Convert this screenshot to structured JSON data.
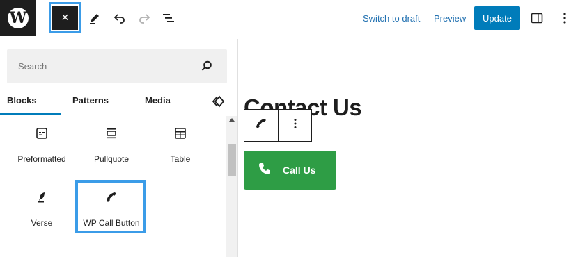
{
  "toolbar": {
    "close_label": "×",
    "switch_to_draft": "Switch to draft",
    "preview": "Preview",
    "update": "Update",
    "logo_glyph": "W"
  },
  "inserter": {
    "search_placeholder": "Search",
    "tabs": [
      {
        "label": "Blocks",
        "active": true
      },
      {
        "label": "Patterns",
        "active": false
      },
      {
        "label": "Media",
        "active": false
      }
    ],
    "blocks": [
      {
        "label": "Preformatted",
        "icon": "preformatted-icon"
      },
      {
        "label": "Pullquote",
        "icon": "pullquote-icon"
      },
      {
        "label": "Table",
        "icon": "table-icon"
      },
      {
        "label": "Verse",
        "icon": "verse-icon"
      },
      {
        "label": "WP Call Button",
        "icon": "phone-icon"
      }
    ]
  },
  "canvas": {
    "page_title": "Contact Us",
    "call_button_label": "Call Us"
  },
  "colors": {
    "accent": "#007cba",
    "highlight": "#3b9ce8",
    "call_button": "#2e9d45",
    "dark": "#1e1e1e"
  }
}
